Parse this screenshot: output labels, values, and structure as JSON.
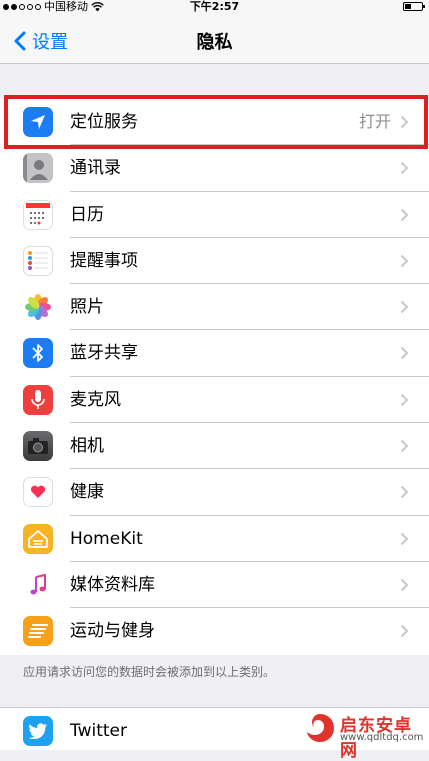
{
  "status_bar": {
    "carrier": "中国移动",
    "time": "下午2:57"
  },
  "nav": {
    "back_label": "设置",
    "title": "隐私"
  },
  "rows": [
    {
      "label": "定位服务",
      "value": "打开",
      "icon": "location-arrow-icon",
      "color": "#1c7cf4"
    },
    {
      "label": "通讯录",
      "icon": "contacts-icon",
      "color": "#a8a8ad"
    },
    {
      "label": "日历",
      "icon": "calendar-icon",
      "color": "#ffffff"
    },
    {
      "label": "提醒事项",
      "icon": "reminders-icon",
      "color": "#ffffff"
    },
    {
      "label": "照片",
      "icon": "photos-icon",
      "color": "#ffffff"
    },
    {
      "label": "蓝牙共享",
      "icon": "bluetooth-icon",
      "color": "#1c7cf4"
    },
    {
      "label": "麦克风",
      "icon": "microphone-icon",
      "color": "#ee3e3d"
    },
    {
      "label": "相机",
      "icon": "camera-icon",
      "color": "#4a4a4d"
    },
    {
      "label": "健康",
      "icon": "heart-icon",
      "color": "#ffffff"
    },
    {
      "label": "HomeKit",
      "icon": "homekit-icon",
      "color": "#f6b322"
    },
    {
      "label": "媒体资料库",
      "icon": "music-note-icon",
      "color": "#ffffff"
    },
    {
      "label": "运动与健身",
      "icon": "motion-icon",
      "color": "#f7a01a"
    }
  ],
  "footer_text": "应用请求访问您的数据时会被添加到以上类别。",
  "twitter_row": {
    "label": "Twitter",
    "icon": "twitter-bird-icon",
    "color": "#1da1f2"
  },
  "watermark": {
    "name": "启东安卓网",
    "url": "www.qdltdq.com"
  },
  "accent_color": "#007aff"
}
